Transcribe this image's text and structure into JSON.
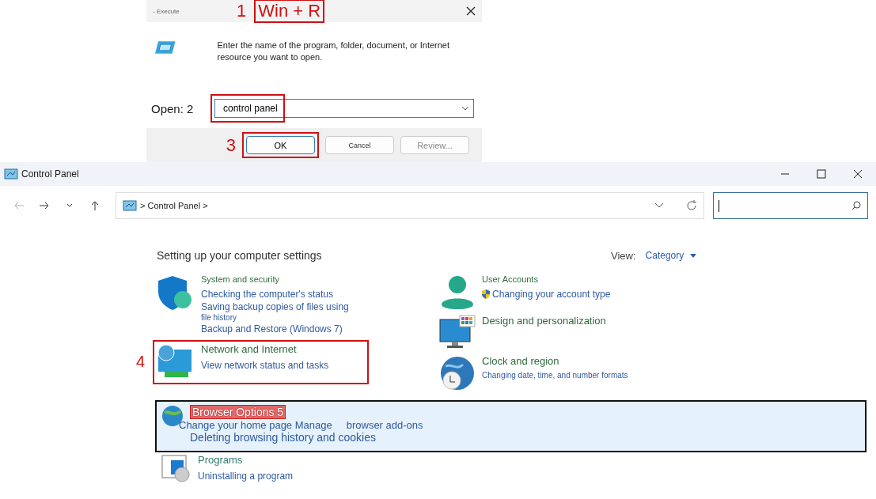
{
  "run_dialog": {
    "title": "- Execute",
    "annotation": {
      "step": "1",
      "label": "Win + R"
    },
    "prompt": "Enter the name of the program, folder, document, or Internet resource you want to open.",
    "open_label": "Open: 2",
    "input": {
      "value": "control panel",
      "highlighted": true
    },
    "buttons": [
      {
        "label": "OK",
        "step": "3",
        "default": true,
        "disabled": false
      },
      {
        "label": "Cancel",
        "default": false,
        "disabled": false
      },
      {
        "label": "Review...",
        "default": false,
        "disabled": true
      }
    ]
  },
  "control_panel": {
    "title": "Control Panel",
    "address": "> Control Panel >",
    "heading": "Setting up your computer settings",
    "view_label": "View:",
    "view_value": "Category",
    "left_column": [
      {
        "kind": "security",
        "title": "System and security",
        "highlighted": false,
        "links": [
          {
            "text": "Checking the computer's status",
            "small": false
          },
          {
            "text": "Saving backup copies of files using",
            "small": false
          },
          {
            "text": "file history",
            "small": true
          },
          {
            "text": "Backup and Restore (Windows 7)",
            "small": false
          }
        ]
      },
      {
        "kind": "network",
        "title": "Network and Internet",
        "step": "4",
        "highlighted": true,
        "links": [
          {
            "text": "View network status and tasks",
            "small": false
          }
        ]
      }
    ],
    "right_column": [
      {
        "kind": "user",
        "title": "User Accounts",
        "highlighted": false,
        "links": [
          {
            "text": "Changing your account type",
            "small": false,
            "shield": true
          }
        ]
      },
      {
        "kind": "display",
        "title": "Design and personalization",
        "highlighted": false
      },
      {
        "kind": "clock",
        "title": "Clock and region",
        "highlighted": false,
        "links": [
          {
            "text": "Changing date, time, and number formats",
            "small": true
          }
        ]
      }
    ],
    "browser_options": {
      "title": "Browser Options 5",
      "links": [
        "Change your home page Manage",
        "browser add-ons"
      ],
      "second_line": "Deleting browsing history and cookies"
    },
    "programs": {
      "title": "Programs",
      "links": [
        "Uninstalling a program"
      ]
    }
  }
}
